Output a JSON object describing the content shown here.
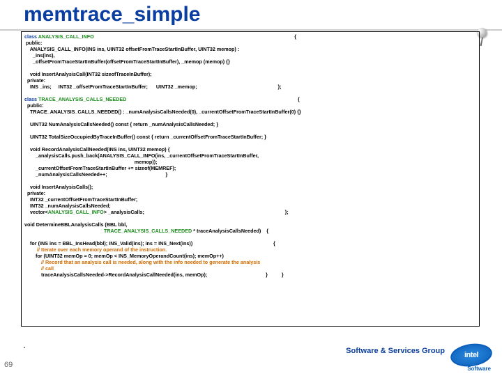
{
  "title": "memtrace_simple",
  "footer": "Software & Services Group",
  "logo_text": "intel",
  "logo_sub": "Software",
  "slide_number": "69",
  "code": {
    "l1a": "class ",
    "l1b": "ANALYSIS_CALL_INFO",
    "l1c": "                                                                                                                                                {",
    "l2": " public:",
    "l3": "    ANALYSIS_CALL_INFO(INS ins, UINT32 offsetFromTraceStartInBuffer, UINT32 memop) :",
    "l4": "      _ins(ins),",
    "l5": "      _offsetFromTraceStartInBuffer(offsetFromTraceStartInBuffer), _memop (memop) {}",
    "blank1": "",
    "l6": "    void InsertAnalysisCall(INT32 sizeofTraceInBuffer);",
    "l7": "  private:",
    "l8": "    INS _ins;     INT32 _offsetFromTraceStartInBuffer;      UINT32 _memop;                                                          };",
    "blank2": "",
    "l9a": "class ",
    "l9b": "TRACE_ANALYSIS_CALLS_NEEDED",
    "l9c": "                                                                                                                           {",
    "l10": "  public:",
    "l11": "    TRACE_ANALYSIS_CALLS_NEEDED() : _numAnalysisCallsNeeded(0), _currentOffsetFromTraceStartInBuffer(0) {}",
    "blank3": "",
    "l12": "    UINT32 NumAnalysisCallsNeeded() const { return _numAnalysisCallsNeeded; }",
    "blank4": "",
    "l13": "    UINT32 TotalSizeOccupiedByTraceInBuffer() const { return _currentOffsetFromTraceStartInBuffer; }",
    "blank5": "",
    "l14": "    void RecordAnalysisCallNeeded(INS ins, UINT32 memop) {",
    "l15": "        _analysisCalls.push_back(ANALYSIS_CALL_INFO(ins, _currentOffsetFromTraceStartInBuffer,",
    "l16": "                                                                               memop));",
    "l17": "        _currentOffsetFromTraceStartInBuffer += sizeof(MEMREF);",
    "l18": "        _numAnalysisCallsNeeded++;                                          }",
    "blank6": "",
    "l19": "    void InsertAnalysisCalls();",
    "l20": "  private:",
    "l21": "    INT32 _currentOffsetFromTraceStartInBuffer;",
    "l22": "    INT32 _numAnalysisCallsNeeded;",
    "l23a": "    vector<",
    "l23b": "ANALYSIS_CALL_INFO",
    "l23c": "> _analysisCalls;                                                                                                     };",
    "blank7": "",
    "l24": "void DetermineBBLAnalysisCalls (BBL bbl,",
    "l25a": "                                                         ",
    "l25b": "TRACE_ANALYSIS_CALLS_NEEDED",
    "l25c": " * traceAnalysisCallsNeeded)    {",
    "blank8": "",
    "l26": "    for (INS ins = BBL_InsHead(bbl); INS_Valid(ins); ins = INS_Next(ins))                                                          {",
    "l27": "         // Iterate over each memory operand of the instruction.",
    "l28": "        for (UINT32 memOp = 0; memOp < INS_MemoryOperandCount(ins); memOp++)",
    "l29": "            // Record that an analysis call is needed, along with the info needed to generate the analysis",
    "l29b": "            // call",
    "l30": "            traceAnalysisCallsNeeded->RecordAnalysisCallNeeded(ins, memOp);                                          }          }"
  }
}
